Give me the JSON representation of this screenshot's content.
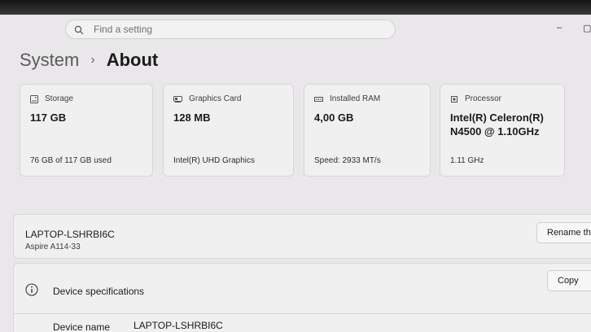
{
  "search": {
    "placeholder": "Find a setting"
  },
  "breadcrumb": {
    "parent": "System",
    "separator": "›",
    "current": "About"
  },
  "cards": [
    {
      "icon": "storage-icon",
      "title": "Storage",
      "value_line1": "117 GB",
      "value_line2": "",
      "sub": "76 GB of 117 GB used"
    },
    {
      "icon": "graphics-card-icon",
      "title": "Graphics Card",
      "value_line1": "128 MB",
      "value_line2": "",
      "sub": "Intel(R) UHD Graphics"
    },
    {
      "icon": "ram-icon",
      "title": "Installed RAM",
      "value_line1": "4,00 GB",
      "value_line2": "",
      "sub": "Speed: 2933 MT/s"
    },
    {
      "icon": "processor-icon",
      "title": "Processor",
      "value_line1": "Intel(R) Celeron(R)",
      "value_line2": "N4500 @ 1.10GHz",
      "sub": "1.11 GHz"
    }
  ],
  "device": {
    "name": "LAPTOP-LSHRBI6C",
    "model": "Aspire A114-33",
    "rename_label": "Rename thi"
  },
  "specs": {
    "title": "Device specifications",
    "copy_label": "Copy",
    "rows": [
      {
        "label": "Device name",
        "value": "LAPTOP-LSHRBI6C"
      }
    ]
  },
  "colors": {
    "background": "#e9e7e9",
    "card": "#f1f0f1",
    "border": "#d8d6d8"
  }
}
